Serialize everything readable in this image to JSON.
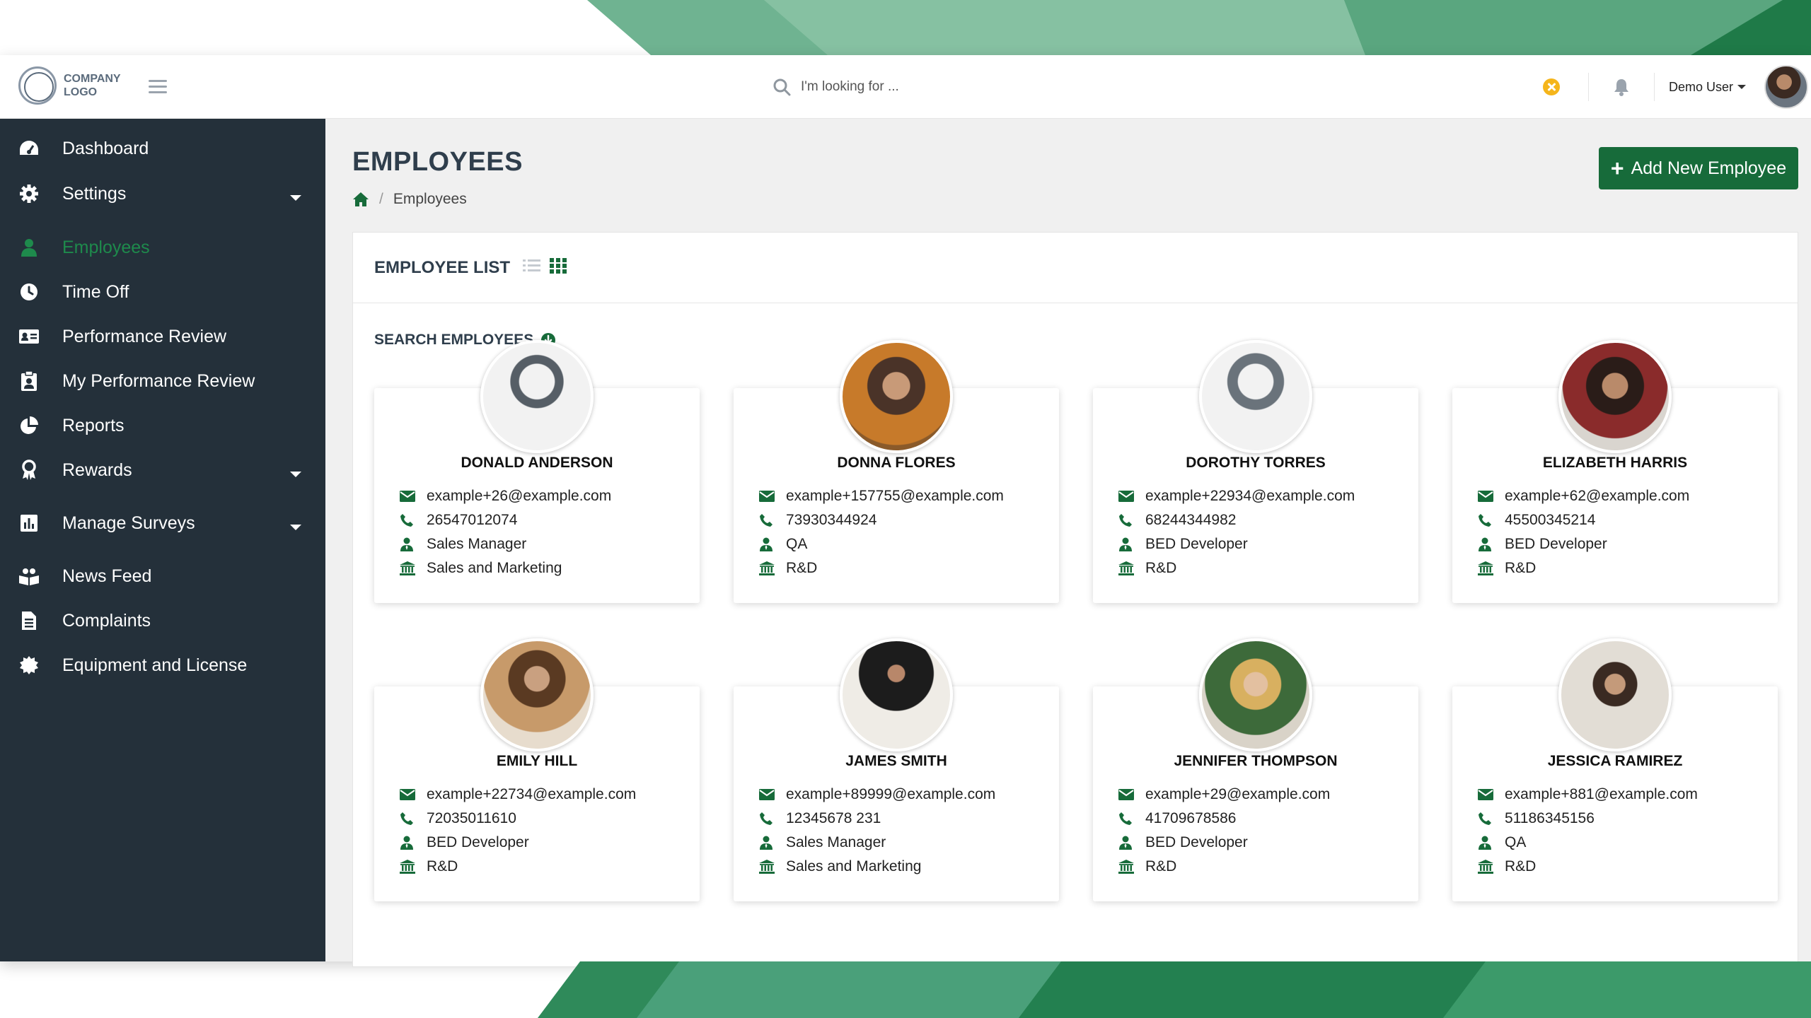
{
  "company": {
    "logo_line1": "COMPANY",
    "logo_line2": "LOGO"
  },
  "header": {
    "search_placeholder": "I'm looking for ...",
    "user_name": "Demo User"
  },
  "sidebar": {
    "items": [
      {
        "label": "Dashboard",
        "icon": "dashboard-icon",
        "expandable": false,
        "active": false
      },
      {
        "label": "Settings",
        "icon": "gear-icon",
        "expandable": true,
        "active": false
      },
      {
        "label": "Employees",
        "icon": "user-icon",
        "expandable": false,
        "active": true
      },
      {
        "label": "Time Off",
        "icon": "clock-icon",
        "expandable": false,
        "active": false
      },
      {
        "label": "Performance Review",
        "icon": "id-card-icon",
        "expandable": false,
        "active": false
      },
      {
        "label": "My Performance Review",
        "icon": "clipboard-user-icon",
        "expandable": false,
        "active": false
      },
      {
        "label": "Reports",
        "icon": "pie-chart-icon",
        "expandable": false,
        "active": false
      },
      {
        "label": "Rewards",
        "icon": "award-icon",
        "expandable": true,
        "active": false
      },
      {
        "label": "Manage Surveys",
        "icon": "bar-chart-icon",
        "expandable": true,
        "active": false
      },
      {
        "label": "News Feed",
        "icon": "news-icon",
        "expandable": false,
        "active": false
      },
      {
        "label": "Complaints",
        "icon": "document-icon",
        "expandable": false,
        "active": false
      },
      {
        "label": "Equipment and License",
        "icon": "badge-icon",
        "expandable": false,
        "active": false
      }
    ]
  },
  "page": {
    "title": "EMPLOYEES",
    "breadcrumb": "Employees",
    "add_button": "Add New Employee",
    "panel_title": "EMPLOYEE LIST",
    "search_label": "SEARCH EMPLOYEES"
  },
  "employees": [
    {
      "name": "DONALD ANDERSON",
      "email": "example+26@example.com",
      "phone": "26547012074",
      "role": "Sales Manager",
      "department": "Sales and Marketing",
      "avatar": "placeholder-male"
    },
    {
      "name": "DONNA FLORES",
      "email": "example+157755@example.com",
      "phone": "73930344924",
      "role": "QA",
      "department": "R&D",
      "avatar": "photo"
    },
    {
      "name": "DOROTHY TORRES",
      "email": "example+22934@example.com",
      "phone": "68244344982",
      "role": "BED Developer",
      "department": "R&D",
      "avatar": "placeholder-female"
    },
    {
      "name": "ELIZABETH HARRIS",
      "email": "example+62@example.com",
      "phone": "45500345214",
      "role": "BED Developer",
      "department": "R&D",
      "avatar": "photo"
    },
    {
      "name": "EMILY HILL",
      "email": "example+22734@example.com",
      "phone": "72035011610",
      "role": "BED Developer",
      "department": "R&D",
      "avatar": "photo"
    },
    {
      "name": "JAMES SMITH",
      "email": "example+89999@example.com",
      "phone": "12345678 231",
      "role": "Sales Manager",
      "department": "Sales and Marketing",
      "avatar": "photo"
    },
    {
      "name": "JENNIFER THOMPSON",
      "email": "example+29@example.com",
      "phone": "41709678586",
      "role": "BED Developer",
      "department": "R&D",
      "avatar": "photo"
    },
    {
      "name": "JESSICA RAMIREZ",
      "email": "example+881@example.com",
      "phone": "51186345156",
      "role": "QA",
      "department": "R&D",
      "avatar": "photo"
    }
  ],
  "colors": {
    "accent": "#176b3a",
    "sidebar_bg": "#24303a",
    "active_nav": "#1e8a4c",
    "status_warning": "#f5b51b"
  }
}
